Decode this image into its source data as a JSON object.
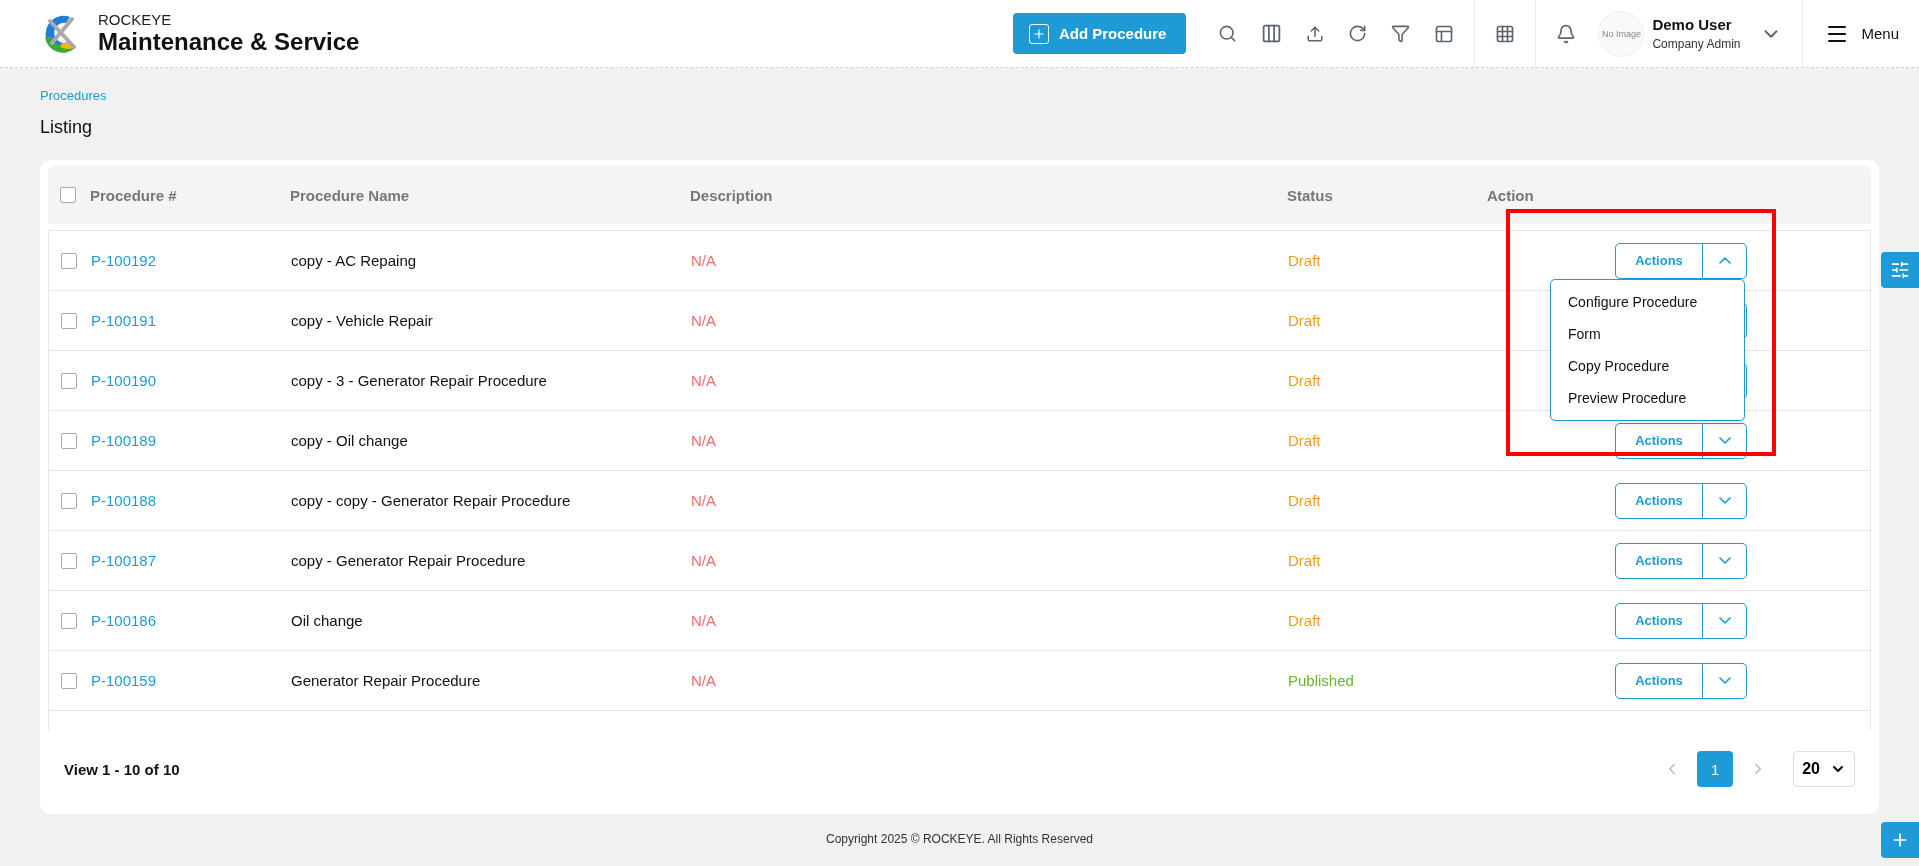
{
  "header": {
    "brand_top": "ROCKEYE",
    "brand_title": "Maintenance & Service",
    "add_button": "Add Procedure",
    "user": {
      "avatar_text": "No Image",
      "name": "Demo User",
      "role": "Company Admin"
    },
    "menu_label": "Menu"
  },
  "breadcrumb": "Procedures",
  "page_title": "Listing",
  "table": {
    "columns": [
      "Procedure #",
      "Procedure Name",
      "Description",
      "Status",
      "Action"
    ],
    "select_all": {
      "checked": false
    },
    "rows": [
      {
        "id": "P-100192",
        "name": "copy - AC Repaing",
        "description": "N/A",
        "status": "Draft",
        "color": "#f39a1e",
        "checked": false,
        "action": "Actions",
        "expanded": true
      },
      {
        "id": "P-100191",
        "name": "copy - Vehicle Repair",
        "description": "N/A",
        "status": "Draft",
        "color": "#f39a1e",
        "checked": false
      },
      {
        "id": "P-100190",
        "name": "copy - 3 - Generator Repair Procedure",
        "description": "N/A",
        "status": "Draft",
        "color": "#f39a1e",
        "checked": false
      },
      {
        "id": "P-100189",
        "name": "copy - Oil change",
        "description": "N/A",
        "status": "Draft",
        "color": "#f39a1e",
        "checked": false,
        "action": "Actions",
        "expanded": false
      },
      {
        "id": "P-100188",
        "name": "copy - copy - Generator Repair Procedure",
        "description": "N/A",
        "status": "Draft",
        "color": "#f39a1e",
        "checked": false,
        "action": "Actions",
        "expanded": false
      },
      {
        "id": "P-100187",
        "name": "copy - Generator Repair Procedure",
        "description": "N/A",
        "status": "Draft",
        "color": "#f39a1e",
        "checked": false,
        "action": "Actions",
        "expanded": false
      },
      {
        "id": "P-100186",
        "name": "Oil change",
        "description": "N/A",
        "status": "Draft",
        "color": "#f39a1e",
        "checked": false,
        "action": "Actions",
        "expanded": false
      },
      {
        "id": "P-100159",
        "name": "Generator Repair Procedure",
        "description": "N/A",
        "status": "Published",
        "color": "#6ab52e",
        "checked": false,
        "action": "Actions",
        "expanded": false
      }
    ],
    "action_menu": [
      "Configure Procedure",
      "Form",
      "Copy Procedure",
      "Preview Procedure"
    ]
  },
  "pagination": {
    "summary": "View 1 - 10 of 10",
    "pages": [
      {
        "label": "1",
        "selected": true
      }
    ],
    "page_size": "20"
  },
  "footer": "Copyright 2025 © ROCKEYE. All Rights Reserved"
}
